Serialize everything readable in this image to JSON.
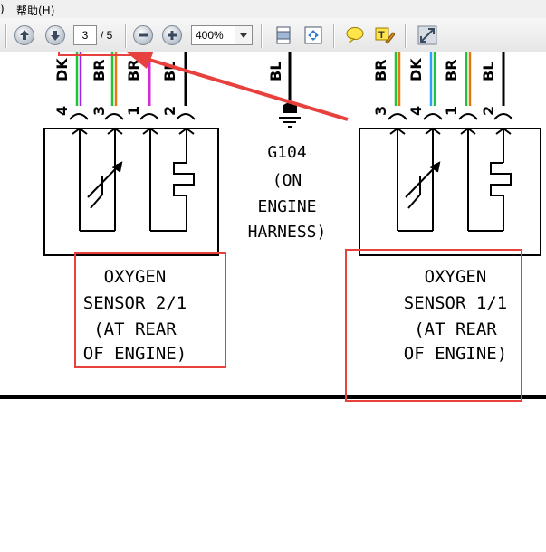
{
  "menu": {
    "paren": ")",
    "help": "帮助(H)"
  },
  "toolbar": {
    "current_page": "3",
    "total_pages": "/ 5",
    "zoom": "400%"
  },
  "diagram": {
    "left_connector": {
      "pins": [
        "4",
        "3",
        "1",
        "2"
      ],
      "wires": [
        "DK",
        "BR",
        "BR",
        "BL"
      ],
      "caption": [
        "OXYGEN",
        "SENSOR 2/1",
        "(AT REAR",
        "OF ENGINE)"
      ]
    },
    "right_connector": {
      "pins": [
        "3",
        "4",
        "1",
        "2"
      ],
      "wires": [
        "BR",
        "DK",
        "BR",
        "BL"
      ],
      "caption": [
        "OXYGEN",
        "SENSOR 1/1",
        "(AT REAR",
        "OF ENGINE)"
      ]
    },
    "ground": {
      "wire": "BL",
      "label": [
        "G104",
        "(ON",
        "ENGINE",
        "HARNESS)"
      ]
    }
  },
  "colors": {
    "highlight": "#e8403c",
    "wire_green": "#22c23a",
    "wire_violet": "#a020f0",
    "wire_blue": "#2aa0ff",
    "wire_orange": "#e07a10",
    "wire_magenta": "#d42ad4"
  },
  "icons": [
    "up-arrow-icon",
    "down-arrow-icon",
    "zoom-out-icon",
    "zoom-in-icon",
    "fit-page-icon",
    "fit-width-icon",
    "comment-icon",
    "highlight-icon",
    "expand-icon"
  ]
}
